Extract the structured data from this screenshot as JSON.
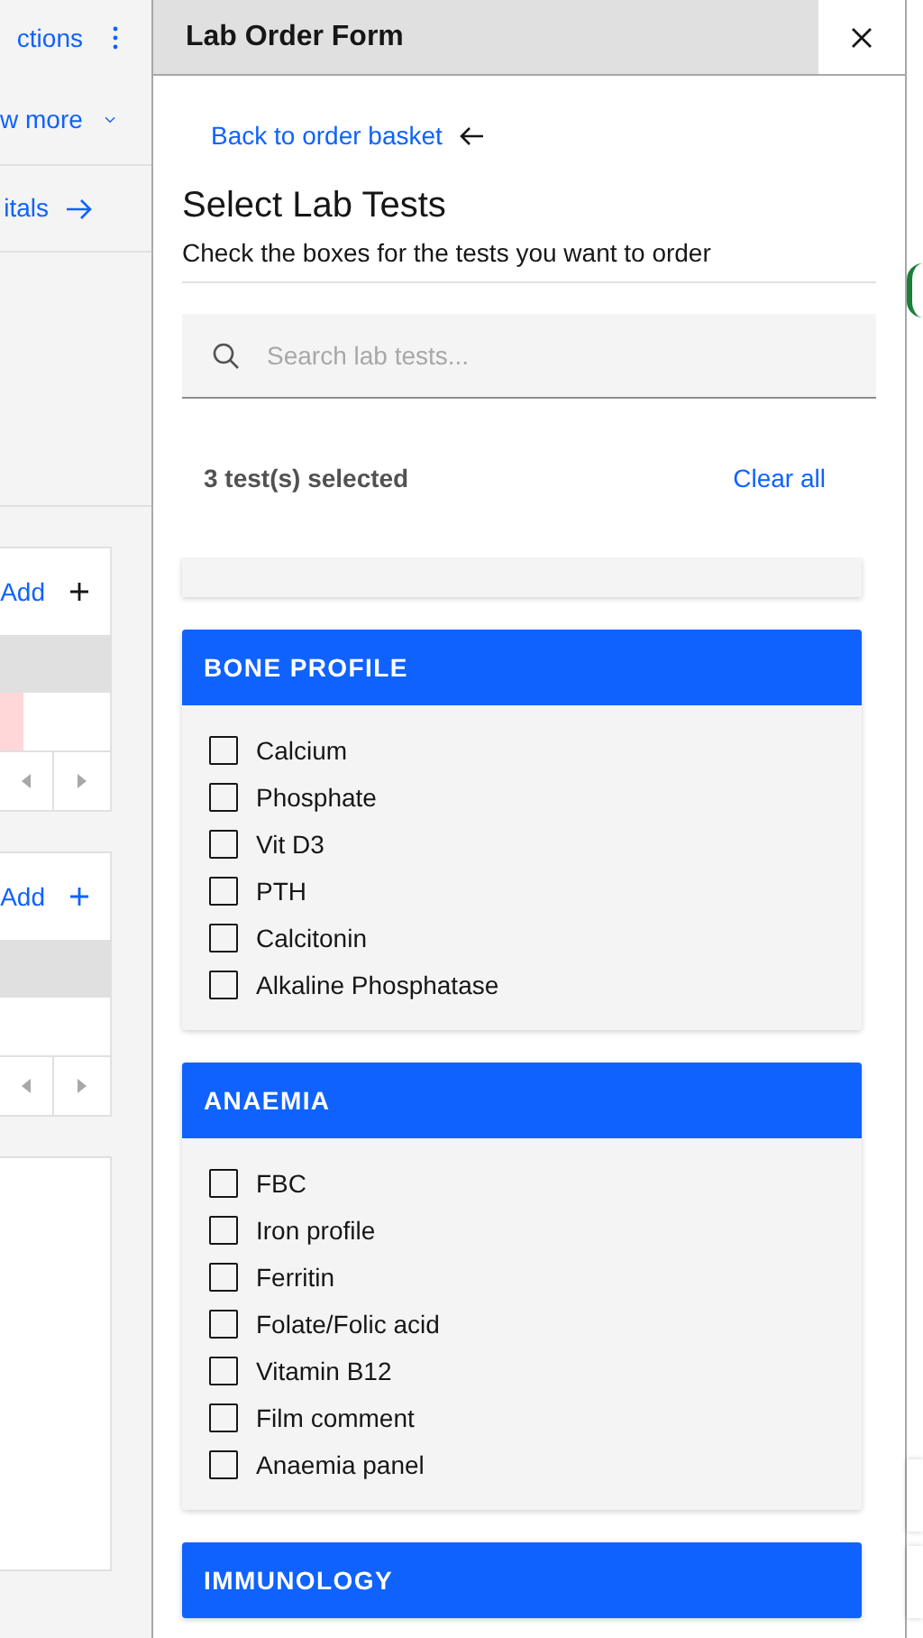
{
  "background": {
    "actions_link": "ctions",
    "show_more_link": "w more",
    "vitals_link": "itals",
    "cards": [
      {
        "add_link": "Add",
        "accent": false
      },
      {
        "add_link": "Add",
        "accent": true
      }
    ]
  },
  "drawer": {
    "title": "Lab Order Form",
    "back_link": "Back to order basket",
    "heading": "Select Lab Tests",
    "subtitle": "Check the boxes for the tests you want to order",
    "search": {
      "placeholder": "Search lab tests..."
    },
    "selected_count": "3 test(s) selected",
    "clear_all": "Clear all",
    "panels": [
      {
        "title": "BONE PROFILE",
        "tests": [
          {
            "label": "Calcium",
            "checked": false
          },
          {
            "label": "Phosphate",
            "checked": false
          },
          {
            "label": "Vit D3",
            "checked": false
          },
          {
            "label": "PTH",
            "checked": false
          },
          {
            "label": "Calcitonin",
            "checked": false
          },
          {
            "label": "Alkaline Phosphatase",
            "checked": false
          }
        ]
      },
      {
        "title": "ANAEMIA",
        "tests": [
          {
            "label": "FBC",
            "checked": false
          },
          {
            "label": "Iron profile",
            "checked": false
          },
          {
            "label": "Ferritin",
            "checked": false
          },
          {
            "label": "Folate/Folic acid",
            "checked": false
          },
          {
            "label": "Vitamin B12",
            "checked": false
          },
          {
            "label": "Film comment",
            "checked": false
          },
          {
            "label": "Anaemia panel",
            "checked": false
          }
        ]
      },
      {
        "title": "IMMUNOLOGY"
      }
    ]
  }
}
